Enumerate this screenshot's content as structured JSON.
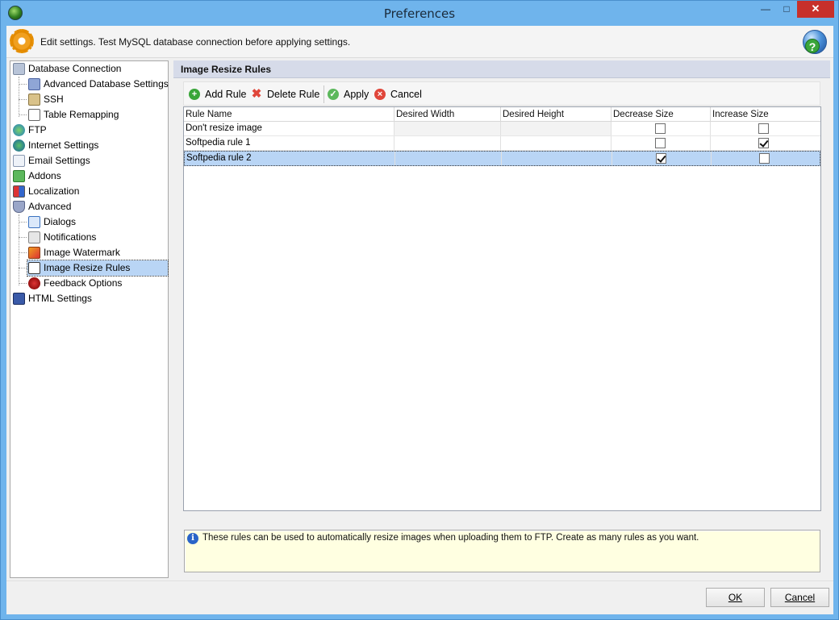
{
  "window": {
    "title": "Preferences",
    "minimize": "—",
    "maximize": "□",
    "close": "✕"
  },
  "info": {
    "text": "Edit settings. Test MySQL database connection before applying settings.",
    "help": "?"
  },
  "tree": {
    "items": [
      {
        "label": "Database Connection",
        "icon": "database-icon"
      },
      {
        "label": "Advanced Database Settings",
        "icon": "settings-icon"
      },
      {
        "label": "SSH",
        "icon": "ssh-icon"
      },
      {
        "label": "Table Remapping",
        "icon": "table-icon"
      },
      {
        "label": "FTP",
        "icon": "ftp-icon"
      },
      {
        "label": "Internet Settings",
        "icon": "globe-icon"
      },
      {
        "label": "Email Settings",
        "icon": "email-icon"
      },
      {
        "label": "Addons",
        "icon": "puzzle-icon"
      },
      {
        "label": "Localization",
        "icon": "flag-icon"
      },
      {
        "label": "Advanced",
        "icon": "shield-icon"
      },
      {
        "label": "Dialogs",
        "icon": "dialog-icon"
      },
      {
        "label": "Notifications",
        "icon": "notification-icon"
      },
      {
        "label": "Image Watermark",
        "icon": "watermark-icon"
      },
      {
        "label": "Image Resize Rules",
        "icon": "resize-icon"
      },
      {
        "label": "Feedback Options",
        "icon": "bug-icon"
      },
      {
        "label": "HTML Settings",
        "icon": "html-icon"
      }
    ]
  },
  "panel": {
    "title": "Image Resize Rules",
    "toolbar": {
      "add": "Add Rule",
      "delete": "Delete Rule",
      "apply": "Apply",
      "cancel": "Cancel"
    },
    "columns": [
      "Rule Name",
      "Desired Width",
      "Desired Height",
      "Decrease Size",
      "Increase Size"
    ],
    "rows": [
      {
        "name": "Don't resize image",
        "width": "",
        "height": "",
        "decrease": false,
        "increase": false
      },
      {
        "name": "Softpedia rule 1",
        "width": "",
        "height": "",
        "decrease": false,
        "increase": true
      },
      {
        "name": "Softpedia rule 2",
        "width": "",
        "height": "",
        "decrease": true,
        "increase": false
      }
    ],
    "hint": "These rules can be used to automatically resize images when uploading them to FTP. Create as many rules as you want."
  },
  "buttons": {
    "ok": "OK",
    "cancel": "Cancel"
  },
  "colors": {
    "titlebar": "#6fb4ec",
    "selection": "#b9d5f5",
    "close": "#c7302b",
    "hint_bg": "#ffffe1"
  }
}
